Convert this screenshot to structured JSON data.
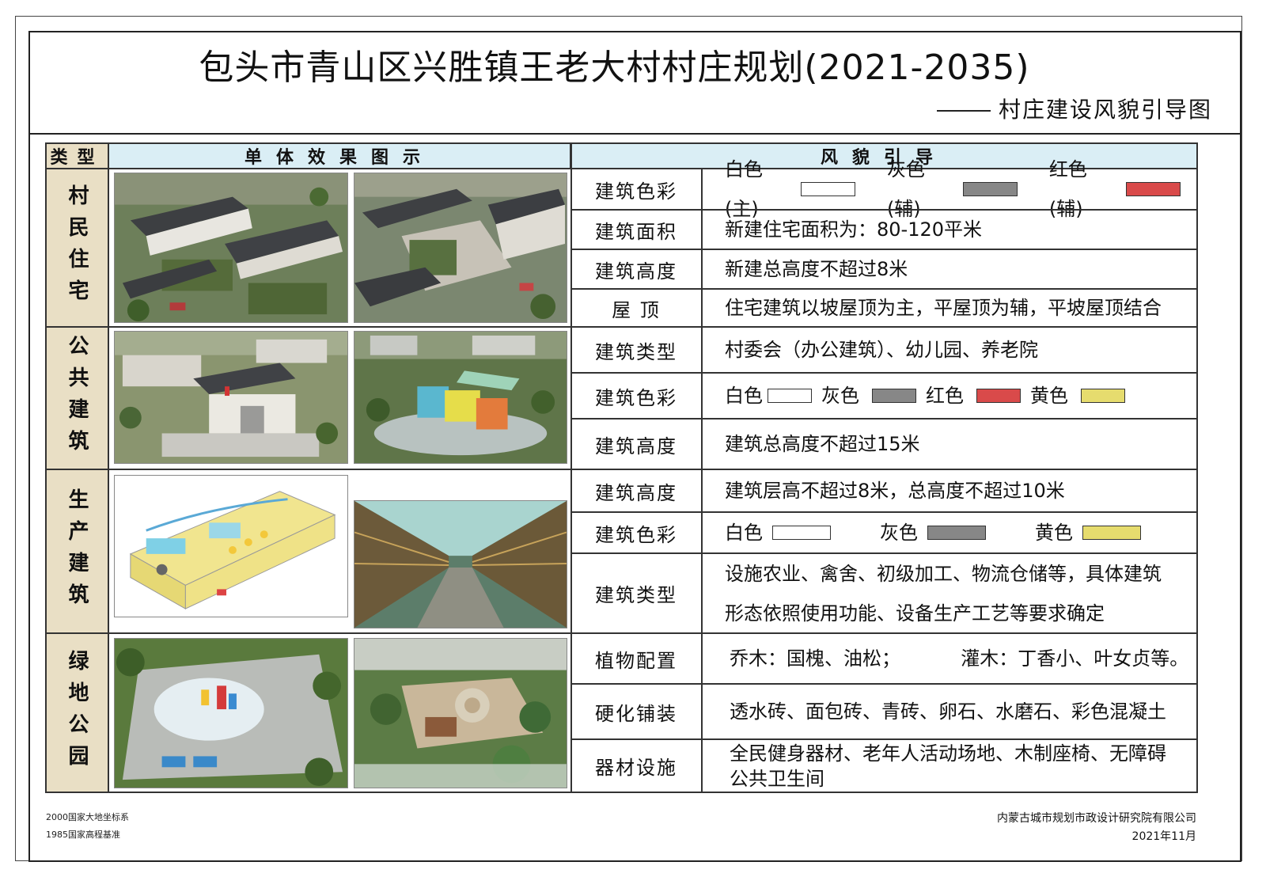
{
  "title": "包头市青山区兴胜镇王老大村村庄规划(2021-2035)",
  "subtitle": "村庄建设风貌引导图",
  "table": {
    "header_type": "类型",
    "header_images": "单体效果图示",
    "header_guide": "风貌引导"
  },
  "sections": [
    {
      "type": "村民住宅",
      "rows": [
        {
          "label": "建筑色彩",
          "swatches": [
            {
              "text": "白色(主)",
              "color": "#ffffff"
            },
            {
              "text": "灰色(辅)",
              "color": "#878787"
            },
            {
              "text": "红色(辅)",
              "color": "#d94a4a"
            }
          ]
        },
        {
          "label": "建筑面积",
          "text": "新建住宅面积为：80-120平米"
        },
        {
          "label": "建筑高度",
          "text": "新建总高度不超过8米"
        },
        {
          "label": "屋 顶",
          "text": "住宅建筑以坡屋顶为主，平屋顶为辅，平坡屋顶结合"
        }
      ]
    },
    {
      "type": "公共建筑",
      "rows": [
        {
          "label": "建筑类型",
          "text": "村委会（办公建筑）、幼儿园、养老院"
        },
        {
          "label": "建筑色彩",
          "swatches": [
            {
              "text": "白色",
              "color": "#ffffff"
            },
            {
              "text": "灰色",
              "color": "#878787"
            },
            {
              "text": "红色",
              "color": "#d94a4a"
            },
            {
              "text": "黄色",
              "color": "#e6dc6e"
            }
          ]
        },
        {
          "label": "建筑高度",
          "text": "建筑总高度不超过15米"
        }
      ]
    },
    {
      "type": "生产建筑",
      "rows": [
        {
          "label": "建筑高度",
          "text": "建筑层高不超过8米，总高度不超过10米"
        },
        {
          "label": "建筑色彩",
          "swatches": [
            {
              "text": "白色",
              "color": "#ffffff"
            },
            {
              "text": "灰色",
              "color": "#878787"
            },
            {
              "text": "黄色",
              "color": "#e6dc6e"
            }
          ]
        },
        {
          "label": "建筑类型",
          "text": "设施农业、禽舍、初级加工、物流仓储等，具体建筑形态依照使用功能、设备生产工艺等要求确定"
        }
      ]
    },
    {
      "type": "绿地公园",
      "rows": [
        {
          "label": "植物配置",
          "text": "乔木：国槐、油松；          灌木：丁香小、叶女贞等。"
        },
        {
          "label": "硬化铺装",
          "text": "透水砖、面包砖、青砖、卵石、水磨石、彩色混凝土"
        },
        {
          "label": "器材设施",
          "text": "全民健身器材、老年人活动场地、木制座椅、无障碍公共卫生间"
        }
      ]
    }
  ],
  "footer": {
    "coord_system": "2000国家大地坐标系",
    "elevation": "1985国家高程基准",
    "company": "内蒙古城市规划市政设计研究院有限公司",
    "date": "2021年11月"
  }
}
